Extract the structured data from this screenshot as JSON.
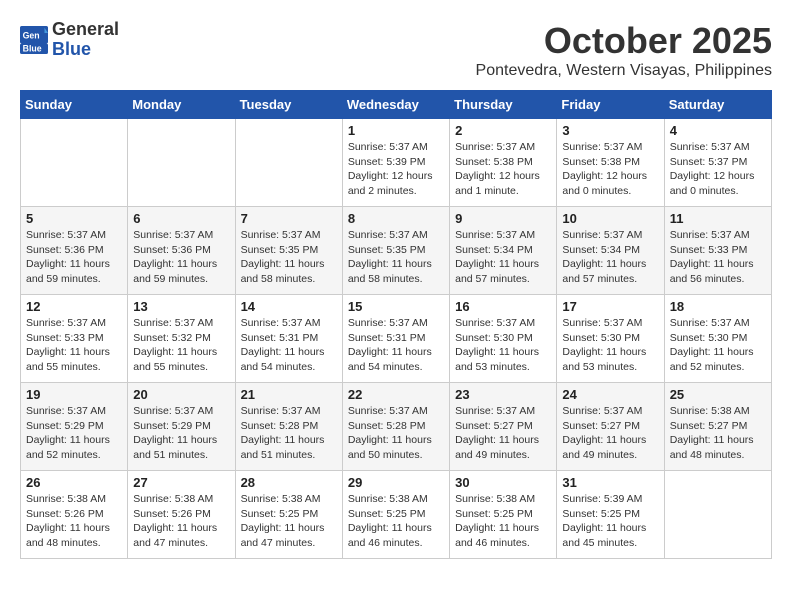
{
  "header": {
    "logo_general": "General",
    "logo_blue": "Blue",
    "month": "October 2025",
    "location": "Pontevedra, Western Visayas, Philippines"
  },
  "weekdays": [
    "Sunday",
    "Monday",
    "Tuesday",
    "Wednesday",
    "Thursday",
    "Friday",
    "Saturday"
  ],
  "weeks": [
    [
      {
        "day": "",
        "info": ""
      },
      {
        "day": "",
        "info": ""
      },
      {
        "day": "",
        "info": ""
      },
      {
        "day": "1",
        "info": "Sunrise: 5:37 AM\nSunset: 5:39 PM\nDaylight: 12 hours\nand 2 minutes."
      },
      {
        "day": "2",
        "info": "Sunrise: 5:37 AM\nSunset: 5:38 PM\nDaylight: 12 hours\nand 1 minute."
      },
      {
        "day": "3",
        "info": "Sunrise: 5:37 AM\nSunset: 5:38 PM\nDaylight: 12 hours\nand 0 minutes."
      },
      {
        "day": "4",
        "info": "Sunrise: 5:37 AM\nSunset: 5:37 PM\nDaylight: 12 hours\nand 0 minutes."
      }
    ],
    [
      {
        "day": "5",
        "info": "Sunrise: 5:37 AM\nSunset: 5:36 PM\nDaylight: 11 hours\nand 59 minutes."
      },
      {
        "day": "6",
        "info": "Sunrise: 5:37 AM\nSunset: 5:36 PM\nDaylight: 11 hours\nand 59 minutes."
      },
      {
        "day": "7",
        "info": "Sunrise: 5:37 AM\nSunset: 5:35 PM\nDaylight: 11 hours\nand 58 minutes."
      },
      {
        "day": "8",
        "info": "Sunrise: 5:37 AM\nSunset: 5:35 PM\nDaylight: 11 hours\nand 58 minutes."
      },
      {
        "day": "9",
        "info": "Sunrise: 5:37 AM\nSunset: 5:34 PM\nDaylight: 11 hours\nand 57 minutes."
      },
      {
        "day": "10",
        "info": "Sunrise: 5:37 AM\nSunset: 5:34 PM\nDaylight: 11 hours\nand 57 minutes."
      },
      {
        "day": "11",
        "info": "Sunrise: 5:37 AM\nSunset: 5:33 PM\nDaylight: 11 hours\nand 56 minutes."
      }
    ],
    [
      {
        "day": "12",
        "info": "Sunrise: 5:37 AM\nSunset: 5:33 PM\nDaylight: 11 hours\nand 55 minutes."
      },
      {
        "day": "13",
        "info": "Sunrise: 5:37 AM\nSunset: 5:32 PM\nDaylight: 11 hours\nand 55 minutes."
      },
      {
        "day": "14",
        "info": "Sunrise: 5:37 AM\nSunset: 5:31 PM\nDaylight: 11 hours\nand 54 minutes."
      },
      {
        "day": "15",
        "info": "Sunrise: 5:37 AM\nSunset: 5:31 PM\nDaylight: 11 hours\nand 54 minutes."
      },
      {
        "day": "16",
        "info": "Sunrise: 5:37 AM\nSunset: 5:30 PM\nDaylight: 11 hours\nand 53 minutes."
      },
      {
        "day": "17",
        "info": "Sunrise: 5:37 AM\nSunset: 5:30 PM\nDaylight: 11 hours\nand 53 minutes."
      },
      {
        "day": "18",
        "info": "Sunrise: 5:37 AM\nSunset: 5:30 PM\nDaylight: 11 hours\nand 52 minutes."
      }
    ],
    [
      {
        "day": "19",
        "info": "Sunrise: 5:37 AM\nSunset: 5:29 PM\nDaylight: 11 hours\nand 52 minutes."
      },
      {
        "day": "20",
        "info": "Sunrise: 5:37 AM\nSunset: 5:29 PM\nDaylight: 11 hours\nand 51 minutes."
      },
      {
        "day": "21",
        "info": "Sunrise: 5:37 AM\nSunset: 5:28 PM\nDaylight: 11 hours\nand 51 minutes."
      },
      {
        "day": "22",
        "info": "Sunrise: 5:37 AM\nSunset: 5:28 PM\nDaylight: 11 hours\nand 50 minutes."
      },
      {
        "day": "23",
        "info": "Sunrise: 5:37 AM\nSunset: 5:27 PM\nDaylight: 11 hours\nand 49 minutes."
      },
      {
        "day": "24",
        "info": "Sunrise: 5:37 AM\nSunset: 5:27 PM\nDaylight: 11 hours\nand 49 minutes."
      },
      {
        "day": "25",
        "info": "Sunrise: 5:38 AM\nSunset: 5:27 PM\nDaylight: 11 hours\nand 48 minutes."
      }
    ],
    [
      {
        "day": "26",
        "info": "Sunrise: 5:38 AM\nSunset: 5:26 PM\nDaylight: 11 hours\nand 48 minutes."
      },
      {
        "day": "27",
        "info": "Sunrise: 5:38 AM\nSunset: 5:26 PM\nDaylight: 11 hours\nand 47 minutes."
      },
      {
        "day": "28",
        "info": "Sunrise: 5:38 AM\nSunset: 5:25 PM\nDaylight: 11 hours\nand 47 minutes."
      },
      {
        "day": "29",
        "info": "Sunrise: 5:38 AM\nSunset: 5:25 PM\nDaylight: 11 hours\nand 46 minutes."
      },
      {
        "day": "30",
        "info": "Sunrise: 5:38 AM\nSunset: 5:25 PM\nDaylight: 11 hours\nand 46 minutes."
      },
      {
        "day": "31",
        "info": "Sunrise: 5:39 AM\nSunset: 5:25 PM\nDaylight: 11 hours\nand 45 minutes."
      },
      {
        "day": "",
        "info": ""
      }
    ]
  ]
}
